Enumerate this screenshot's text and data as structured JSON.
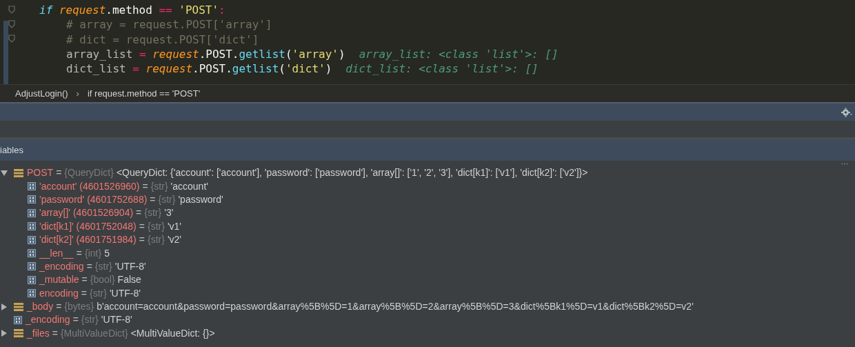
{
  "editor": {
    "lines": [
      [
        {
          "kind": "keyword",
          "text": "if "
        },
        {
          "kind": "param",
          "text": "request"
        },
        {
          "kind": "plain",
          "text": ".method "
        },
        {
          "kind": "op",
          "text": "=="
        },
        {
          "kind": "string",
          "text": " 'POST'"
        },
        {
          "kind": "op",
          "text": ":"
        }
      ],
      [
        {
          "kind": "comment",
          "text": "# array = request.POST['array']"
        }
      ],
      [
        {
          "kind": "comment",
          "text": "# dict = request.POST['dict']"
        }
      ],
      [
        {
          "kind": "dim",
          "text": "array_list "
        },
        {
          "kind": "op",
          "text": "= "
        },
        {
          "kind": "param",
          "text": "request"
        },
        {
          "kind": "plain",
          "text": ".POST."
        },
        {
          "kind": "func",
          "text": "getlist"
        },
        {
          "kind": "plain",
          "text": "("
        },
        {
          "kind": "string",
          "text": "'array'"
        },
        {
          "kind": "plain",
          "text": ")"
        },
        {
          "kind": "hint",
          "text": "array_list: <class 'list'>: []"
        }
      ],
      [
        {
          "kind": "dim",
          "text": "dict_list "
        },
        {
          "kind": "op",
          "text": "= "
        },
        {
          "kind": "param",
          "text": "request"
        },
        {
          "kind": "plain",
          "text": ".POST."
        },
        {
          "kind": "func",
          "text": "getlist"
        },
        {
          "kind": "plain",
          "text": "("
        },
        {
          "kind": "string",
          "text": "'dict'"
        },
        {
          "kind": "plain",
          "text": ")"
        },
        {
          "kind": "hint",
          "text": "dict_list: <class 'list'>: []"
        }
      ]
    ]
  },
  "breadcrumb": [
    "AdjustLogin()",
    "if request.method == 'POST'"
  ],
  "breadcrumb_separator": "›",
  "variables_header": "iables",
  "variables": [
    {
      "kind": "dict",
      "expanded": true,
      "name": "POST",
      "sign": "=",
      "type": "{QueryDict}",
      "value": "<QueryDict: {'account': ['account'], 'password': ['password'], 'array[]': ['1', '2', '3'], 'dict[k1]': ['v1'], 'dict[k2]': ['v2']}>",
      "children": [
        {
          "kind": "field",
          "name": "'account' (4601526960)",
          "sign": "=",
          "type": "{str}",
          "value": "'account'"
        },
        {
          "kind": "field",
          "name": "'password' (4601752688)",
          "sign": "=",
          "type": "{str}",
          "value": "'password'"
        },
        {
          "kind": "field",
          "name": "'array[]' (4601526904)",
          "sign": "=",
          "type": "{str}",
          "value": "'3'"
        },
        {
          "kind": "field",
          "name": "'dict[k1]' (4601752048)",
          "sign": "=",
          "type": "{str}",
          "value": "'v1'"
        },
        {
          "kind": "field",
          "name": "'dict[k2]' (4601751984)",
          "sign": "=",
          "type": "{str}",
          "value": "'v2'"
        },
        {
          "kind": "field",
          "name": "__len__",
          "sign": "=",
          "type": "{int}",
          "value": "5"
        },
        {
          "kind": "field",
          "name": "_encoding",
          "sign": "=",
          "type": "{str}",
          "value": "'UTF-8'"
        },
        {
          "kind": "field",
          "name": "_mutable",
          "sign": "=",
          "type": "{bool}",
          "value": "False"
        },
        {
          "kind": "field",
          "name": "encoding",
          "sign": "=",
          "type": "{str}",
          "value": "'UTF-8'"
        }
      ]
    },
    {
      "kind": "dict",
      "expanded": false,
      "name": "_body",
      "sign": "=",
      "type": "{bytes}",
      "value": "b'account=account&password=password&array%5B%5D=1&array%5B%5D=2&array%5B%5D=3&dict%5Bk1%5D=v1&dict%5Bk2%5D=v2'"
    },
    {
      "kind": "field",
      "name": "_encoding",
      "sign": "=",
      "type": "{str}",
      "value": "'UTF-8'"
    },
    {
      "kind": "dict",
      "expanded": false,
      "name": "_files",
      "sign": "=",
      "type": "{MultiValueDict}",
      "value": "<MultiValueDict: {}>"
    }
  ]
}
